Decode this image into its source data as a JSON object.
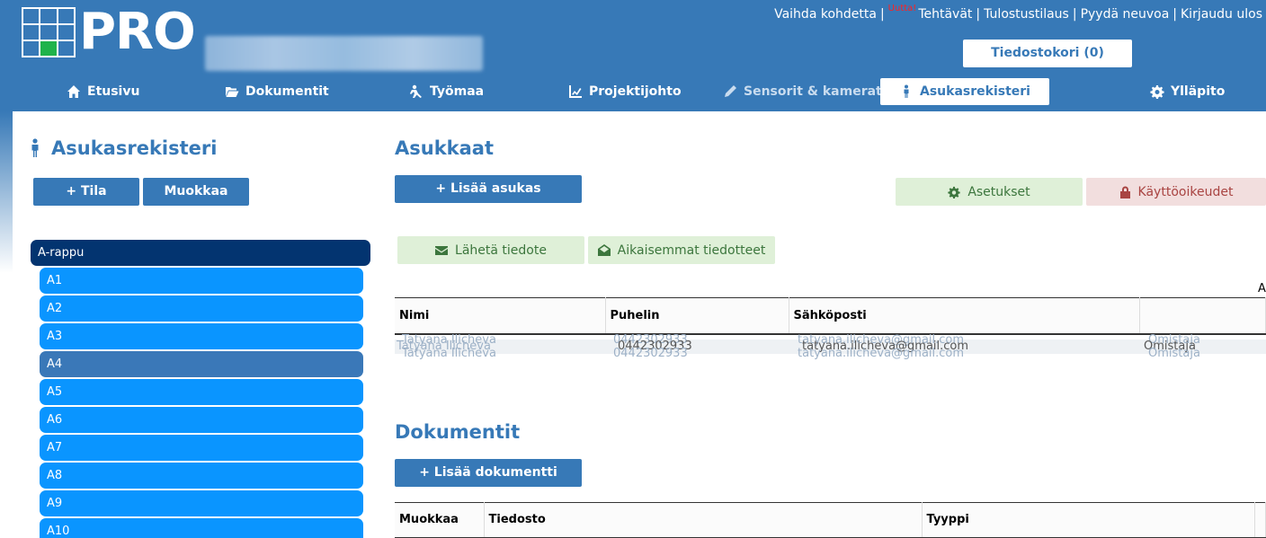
{
  "header": {
    "logo_text": "PRO",
    "top_links": {
      "vaihda": "Vaihda kohdetta",
      "new_badge": "Uutta!",
      "tehtavat": "Tehtävät",
      "tulostus": "Tulostustilaus",
      "pyyda": "Pyydä neuvoa",
      "kirjaudu": "Kirjaudu ulos"
    },
    "cart_label": "Tiedostokori (0)"
  },
  "nav": {
    "items": [
      {
        "label": "Etusivu",
        "icon": "home-icon"
      },
      {
        "label": "Dokumentit",
        "icon": "folder-open-icon"
      },
      {
        "label": "Työmaa",
        "icon": "worker-icon"
      },
      {
        "label": "Projektijohto",
        "icon": "chart-icon"
      },
      {
        "label": "Sensorit & kamerat",
        "icon": "pen-icon",
        "disabled": true
      },
      {
        "label": "Asukasrekisteri",
        "icon": "person-icon",
        "active": true
      },
      {
        "label": "Ylläpito",
        "icon": "gear-icon"
      }
    ]
  },
  "sidebar": {
    "title": "Asukasrekisteri",
    "add_label": "+ Tila",
    "edit_label": "Muokkaa",
    "parent": "A-rappu",
    "items": [
      "A1",
      "A2",
      "A3",
      "A4",
      "A5",
      "A6",
      "A7",
      "A8",
      "A9",
      "A10"
    ],
    "selected": "A4"
  },
  "residents": {
    "title": "Asukkaat",
    "add_label": "+ Lisää asukas",
    "settings_label": "Asetukset",
    "permissions_label": "Käyttöoikeudet",
    "send_notice_label": "Lähetä tiedote",
    "previous_notices_label": "Aikaisemmat tiedotteet",
    "stray_text": "A",
    "columns": [
      "Nimi",
      "Puhelin",
      "Sähköposti",
      ""
    ],
    "rows": [
      {
        "name": "Tatyana Ilicheva",
        "phone": "0442302933",
        "email": "tatyana.ilicheva@gmail.com",
        "role": "Omistaja"
      }
    ]
  },
  "documents": {
    "title": "Dokumentit",
    "add_label": "+ Lisää dokumentti",
    "columns": [
      "Muokkaa",
      "Tiedosto",
      "Tyyppi",
      ""
    ]
  },
  "colors": {
    "primary": "#3779b7",
    "tree_parent": "#033470",
    "tree_item": "#0a95ff",
    "success_bg": "#dff0d8",
    "danger_bg": "#f2dede"
  }
}
